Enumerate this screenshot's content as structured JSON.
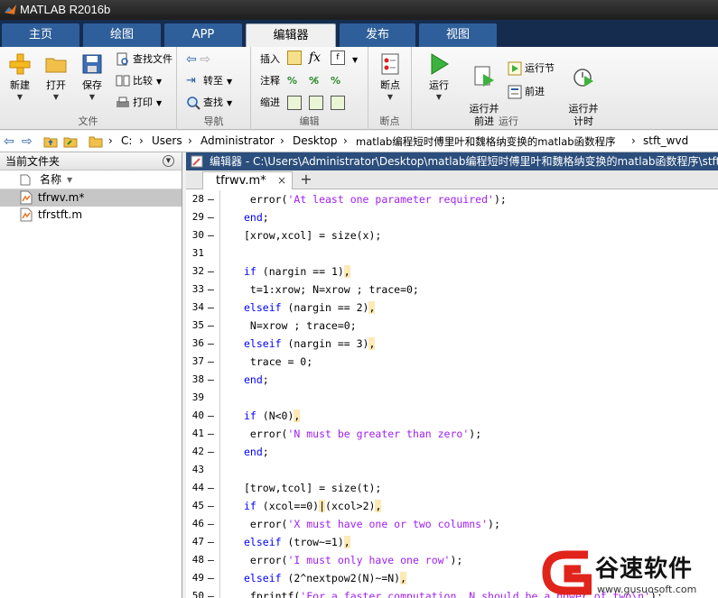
{
  "window": {
    "title": "MATLAB R2016b"
  },
  "ribbon_tabs": [
    "主页",
    "绘图",
    "APP",
    "编辑器",
    "发布",
    "视图"
  ],
  "ribbon": {
    "file": {
      "label": "文件",
      "new": "新建",
      "open": "打开",
      "save": "保存",
      "find_files": "查找文件",
      "compare": "比较",
      "print": "打印"
    },
    "navigate": {
      "label": "导航",
      "goto": "转至",
      "find": "查找"
    },
    "edit": {
      "label": "编辑",
      "insert": "插入",
      "comment": "注释",
      "indent": "缩进",
      "fx": "fx"
    },
    "breakpoints": {
      "label": "断点",
      "breakpoints": "断点"
    },
    "run": {
      "label": "运行",
      "run": "运行",
      "run_advance": "运行并\n前进",
      "run_section": "运行节",
      "advance": "前进",
      "run_time": "运行并\n计时"
    }
  },
  "address": {
    "crumbs": [
      "C:",
      "Users",
      "Administrator",
      "Desktop",
      "matlab编程短时傅里叶和魏格纳变换的matlab函数程序",
      "stft_wvd"
    ]
  },
  "current_folder": {
    "title": "当前文件夹",
    "column": "名称",
    "files": [
      {
        "name": "tfrwv.m*",
        "selected": true
      },
      {
        "name": "tfrstft.m",
        "selected": false
      }
    ]
  },
  "editor": {
    "title": "编辑器 - C:\\Users\\Administrator\\Desktop\\matlab编程短时傅里叶和魏格纳变换的matlab函数程序\\stft_",
    "tab": "tfrwv.m*",
    "tab_close": "×",
    "plus": "+",
    "lines": [
      {
        "n": "28",
        "dash": "–",
        "segs": [
          {
            "t": " error(",
            "c": ""
          },
          {
            "t": "'At least one parameter required'",
            "c": "str"
          },
          {
            "t": ");",
            "c": ""
          }
        ]
      },
      {
        "n": "29",
        "dash": "–",
        "segs": [
          {
            "t": "end",
            "c": "kw"
          },
          {
            "t": ";",
            "c": ""
          }
        ]
      },
      {
        "n": "30",
        "dash": "–",
        "segs": [
          {
            "t": "[xrow,xcol] = size(x);",
            "c": ""
          }
        ]
      },
      {
        "n": "31",
        "dash": "",
        "segs": []
      },
      {
        "n": "32",
        "dash": "–",
        "segs": [
          {
            "t": "if",
            "c": "kw"
          },
          {
            "t": " (nargin == 1)",
            "c": ""
          },
          {
            "t": ",",
            "c": "mark"
          }
        ]
      },
      {
        "n": "33",
        "dash": "–",
        "segs": [
          {
            "t": " t=1:xrow; N=xrow ; trace=0;",
            "c": ""
          }
        ]
      },
      {
        "n": "34",
        "dash": "–",
        "segs": [
          {
            "t": "elseif",
            "c": "kw"
          },
          {
            "t": " (nargin == 2)",
            "c": ""
          },
          {
            "t": ",",
            "c": "mark"
          }
        ]
      },
      {
        "n": "35",
        "dash": "–",
        "segs": [
          {
            "t": " N=xrow ; trace=0;",
            "c": ""
          }
        ]
      },
      {
        "n": "36",
        "dash": "–",
        "segs": [
          {
            "t": "elseif",
            "c": "kw"
          },
          {
            "t": " (nargin == 3)",
            "c": ""
          },
          {
            "t": ",",
            "c": "mark"
          }
        ]
      },
      {
        "n": "37",
        "dash": "–",
        "segs": [
          {
            "t": " trace = 0;",
            "c": ""
          }
        ]
      },
      {
        "n": "38",
        "dash": "–",
        "segs": [
          {
            "t": "end",
            "c": "kw"
          },
          {
            "t": ";",
            "c": ""
          }
        ]
      },
      {
        "n": "39",
        "dash": "",
        "segs": []
      },
      {
        "n": "40",
        "dash": "–",
        "segs": [
          {
            "t": "if",
            "c": "kw"
          },
          {
            "t": " (N<0)",
            "c": ""
          },
          {
            "t": ",",
            "c": "mark"
          }
        ]
      },
      {
        "n": "41",
        "dash": "–",
        "segs": [
          {
            "t": " error(",
            "c": ""
          },
          {
            "t": "'N must be greater than zero'",
            "c": "str"
          },
          {
            "t": ");",
            "c": ""
          }
        ]
      },
      {
        "n": "42",
        "dash": "–",
        "segs": [
          {
            "t": "end",
            "c": "kw"
          },
          {
            "t": ";",
            "c": ""
          }
        ]
      },
      {
        "n": "43",
        "dash": "",
        "segs": []
      },
      {
        "n": "44",
        "dash": "–",
        "segs": [
          {
            "t": "[trow,tcol] = size(t);",
            "c": ""
          }
        ]
      },
      {
        "n": "45",
        "dash": "–",
        "segs": [
          {
            "t": "if",
            "c": "kw"
          },
          {
            "t": " (xcol==0)",
            "c": ""
          },
          {
            "t": "|",
            "c": "mark"
          },
          {
            "t": "(xcol>2)",
            "c": ""
          },
          {
            "t": ",",
            "c": "mark"
          }
        ]
      },
      {
        "n": "46",
        "dash": "–",
        "segs": [
          {
            "t": " error(",
            "c": ""
          },
          {
            "t": "'X must have one or two columns'",
            "c": "str"
          },
          {
            "t": ");",
            "c": ""
          }
        ]
      },
      {
        "n": "47",
        "dash": "–",
        "segs": [
          {
            "t": "elseif",
            "c": "kw"
          },
          {
            "t": " (trow~=1)",
            "c": ""
          },
          {
            "t": ",",
            "c": "mark"
          }
        ]
      },
      {
        "n": "48",
        "dash": "–",
        "segs": [
          {
            "t": " error(",
            "c": ""
          },
          {
            "t": "'I must only have one row'",
            "c": "str"
          },
          {
            "t": ");",
            "c": ""
          }
        ]
      },
      {
        "n": "49",
        "dash": "–",
        "segs": [
          {
            "t": "elseif",
            "c": "kw"
          },
          {
            "t": " (2^nextpow2(N)~=N)",
            "c": ""
          },
          {
            "t": ",",
            "c": "mark"
          }
        ]
      },
      {
        "n": "50",
        "dash": "–",
        "segs": [
          {
            "t": " fprintf(",
            "c": ""
          },
          {
            "t": "'For a faster computation, N should be a power of two\\n'",
            "c": "str"
          },
          {
            "t": ");",
            "c": ""
          }
        ]
      }
    ]
  },
  "watermark": {
    "text": "谷速软件",
    "url": "www.gusuosoft.com"
  },
  "colors": {
    "title_bg": "#1d1d1d",
    "tab_strip": "#152c4f",
    "tab_bg": "#2f5f9a",
    "editor_title": "#2b4e7c",
    "keyword": "#0000ff",
    "string": "#a020f0",
    "watermark_red": "#e0231b"
  }
}
